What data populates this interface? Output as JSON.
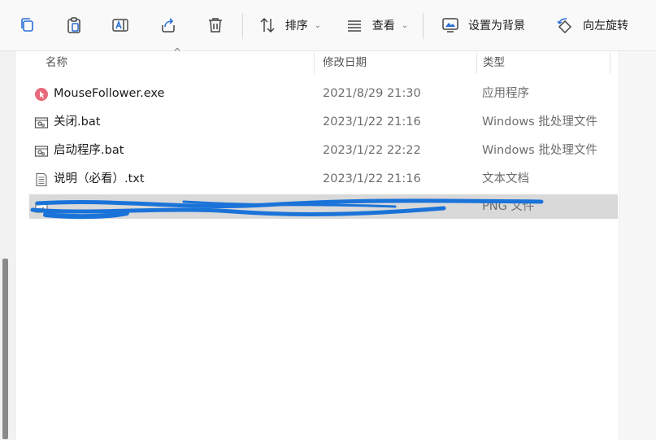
{
  "toolbar": {
    "sort_label": "排序",
    "view_label": "查看",
    "set_background_label": "设置为背景",
    "rotate_left_label": "向左旋转"
  },
  "columns": {
    "name": "名称",
    "modified": "修改日期",
    "type": "类型"
  },
  "files": [
    {
      "icon": "exe-app-icon",
      "name": "MouseFollower.exe",
      "date": "2021/8/29 21:30",
      "type": "应用程序"
    },
    {
      "icon": "bat-file-icon",
      "name": "关闭.bat",
      "date": "2023/1/22 21:16",
      "type": "Windows 批处理文件"
    },
    {
      "icon": "bat-file-icon",
      "name": "启动程序.bat",
      "date": "2023/1/22 22:22",
      "type": "Windows 批处理文件"
    },
    {
      "icon": "txt-file-icon",
      "name": "说明（必看）.txt",
      "date": "2023/1/22 21:16",
      "type": "文本文档"
    },
    {
      "icon": "png-file-icon",
      "name": "",
      "date": "",
      "type": "PNG 文件",
      "selected": true,
      "redacted": true
    }
  ],
  "colors": {
    "selection": "#d9d9d9",
    "redaction_ink": "#1a73d9",
    "exe_icon": "#e86a7a"
  }
}
